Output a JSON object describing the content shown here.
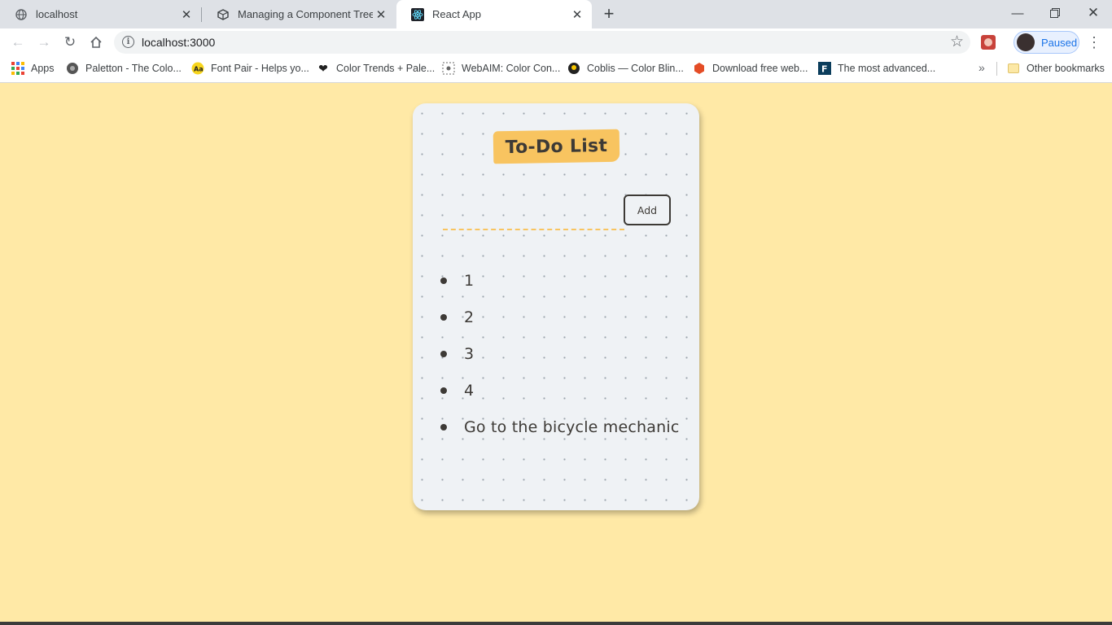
{
  "browser": {
    "tabs": [
      {
        "title": "localhost",
        "icon": "globe-icon",
        "active": false
      },
      {
        "title": "Managing a Component Tree Pra",
        "icon": "codesandbox-icon",
        "active": false
      },
      {
        "title": "React App",
        "icon": "react-icon",
        "active": true
      }
    ],
    "url": "localhost:3000",
    "profile_label": "Paused",
    "bookmarks": [
      {
        "label": "Apps",
        "icon": "apps-grid-icon"
      },
      {
        "label": "Paletton - The Colo...",
        "icon": "paletton-icon"
      },
      {
        "label": "Font Pair - Helps yo...",
        "icon": "fontpair-icon"
      },
      {
        "label": "Color Trends + Pale...",
        "icon": "heart-icon"
      },
      {
        "label": "WebAIM: Color Con...",
        "icon": "webaim-icon"
      },
      {
        "label": "Coblis — Color Blin...",
        "icon": "coblis-icon"
      },
      {
        "label": "Download free web...",
        "icon": "hexagon-icon"
      },
      {
        "label": "The most advanced...",
        "icon": "f-icon"
      }
    ],
    "other_bookmarks": "Other bookmarks"
  },
  "app": {
    "heading": "To-Do List",
    "input_value": "",
    "add_button": "Add",
    "items": [
      "1",
      "2",
      "3",
      "4",
      "Go to the bicycle mechanic"
    ]
  },
  "colors": {
    "page_background": "#ffe9a6",
    "card_background": "#eff2f5",
    "accent": "#f8c460",
    "text": "#3d3a36"
  }
}
